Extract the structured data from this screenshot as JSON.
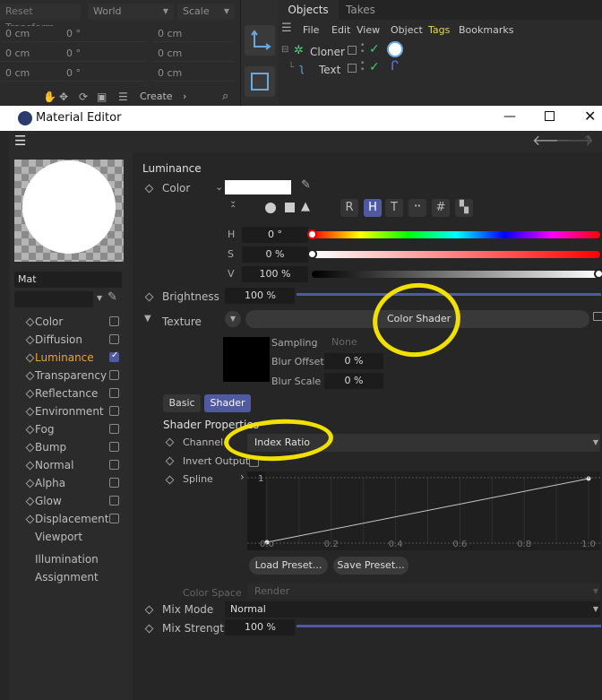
{
  "top": {
    "reset_transform": "Reset Transform",
    "world": "World",
    "scale": "Scale",
    "coords": [
      [
        "0 cm",
        "0 °",
        "0 cm"
      ],
      [
        "0 cm",
        "0 °",
        "0 cm"
      ],
      [
        "0 cm",
        "0 °",
        "0 cm"
      ]
    ],
    "create_label": "Create",
    "objects_tab": "Objects",
    "takes_tab": "Takes",
    "menu": [
      "File",
      "Edit",
      "View",
      "Object",
      "Tags",
      "Bookmarks"
    ],
    "tree": [
      {
        "name": "Cloner"
      },
      {
        "name": "Text"
      }
    ]
  },
  "editor": {
    "title": "Material Editor",
    "material_name": "Mat",
    "channels": [
      {
        "label": "Color",
        "checked": false,
        "active": false
      },
      {
        "label": "Diffusion",
        "checked": false,
        "active": false
      },
      {
        "label": "Luminance",
        "checked": true,
        "active": true
      },
      {
        "label": "Transparency",
        "checked": false,
        "active": false
      },
      {
        "label": "Reflectance",
        "checked": false,
        "active": false
      },
      {
        "label": "Environment",
        "checked": false,
        "active": false
      },
      {
        "label": "Fog",
        "checked": false,
        "active": false
      },
      {
        "label": "Bump",
        "checked": false,
        "active": false
      },
      {
        "label": "Normal",
        "checked": false,
        "active": false
      },
      {
        "label": "Alpha",
        "checked": false,
        "active": false
      },
      {
        "label": "Glow",
        "checked": false,
        "active": false
      },
      {
        "label": "Displacement",
        "checked": false,
        "active": false
      }
    ],
    "extra_items": [
      "Viewport",
      "Illumination",
      "Assignment"
    ],
    "section_title": "Luminance",
    "color_label": "Color",
    "mode_buttons": [
      "R",
      "H",
      "T",
      "",
      ""
    ],
    "hsv": {
      "h_label": "H",
      "h_value": "0 °",
      "s_label": "S",
      "s_value": "0 %",
      "v_label": "V",
      "v_value": "100 %",
      "v_level": 1.0
    },
    "brightness_label": "Brightness",
    "brightness_value": "100 %",
    "texture_label": "Texture",
    "texture_shader": "Color Shader",
    "sampling_label": "Sampling",
    "sampling_value": "None",
    "blur_offset_label": "Blur Offset",
    "blur_offset_value": "0 %",
    "blur_scale_label": "Blur Scale",
    "blur_scale_value": "0 %",
    "tabs": [
      {
        "label": "Basic",
        "active": false
      },
      {
        "label": "Shader",
        "active": true
      }
    ],
    "shader_properties_label": "Shader Properties",
    "channel_label": "Channel",
    "channel_value": "Index Ratio",
    "invert_output_label": "Invert Output",
    "spline_label": "Spline",
    "spline_ticks": [
      "0.0",
      "0.2",
      "0.4",
      "0.6",
      "0.8",
      "1.0"
    ],
    "spline_y_top": "1",
    "load_preset": "Load Preset...",
    "save_preset": "Save Preset...",
    "color_space_label": "Color Space",
    "color_space_value": "Render",
    "mix_mode_label": "Mix Mode",
    "mix_mode_value": "Normal",
    "mix_strength_label": "Mix Strength",
    "mix_strength_value": "100 %",
    "mix_strength_level": 1.0
  },
  "colors": {
    "accent": "#4f5aa0",
    "highlight": "#f2e000",
    "check": "#3ccf6b"
  }
}
